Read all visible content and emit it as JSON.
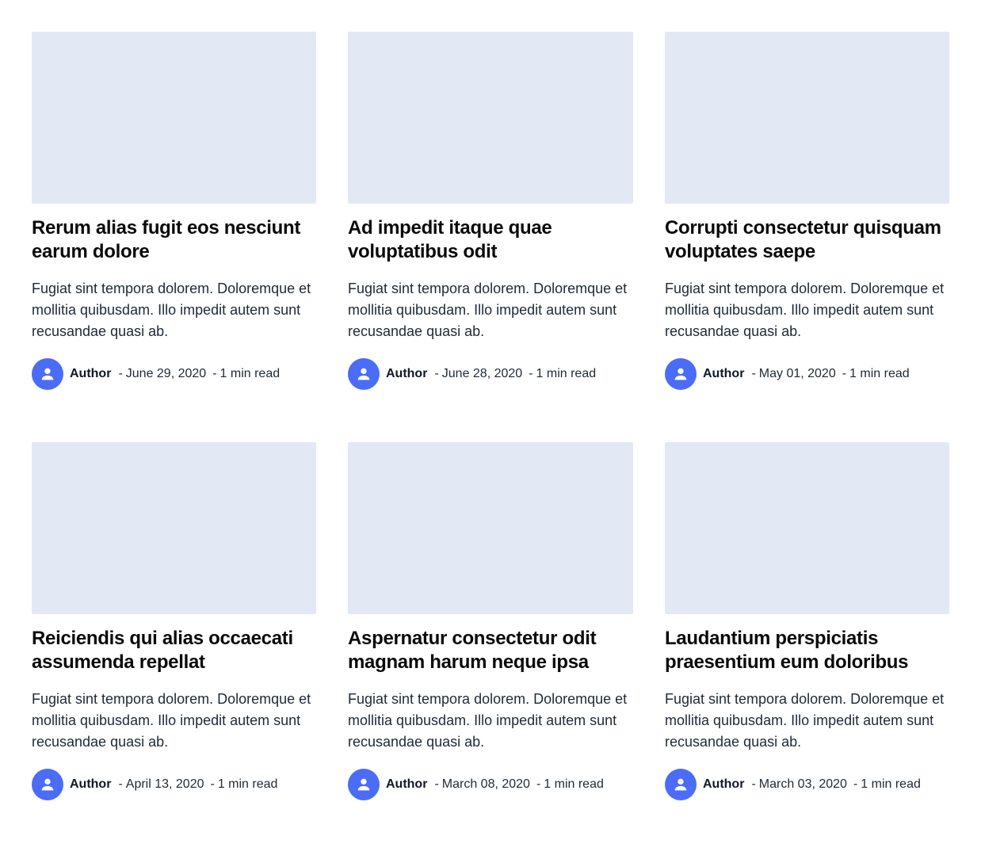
{
  "posts": [
    {
      "title": "Rerum alias fugit eos nesciunt earum dolore",
      "excerpt": "Fugiat sint tempora dolorem. Doloremque et mollitia quibusdam. Illo impedit autem sunt recusandae quasi ab.",
      "author": "Author",
      "date": "June 29, 2020",
      "read_time": "1 min read"
    },
    {
      "title": "Ad impedit itaque quae voluptatibus odit",
      "excerpt": "Fugiat sint tempora dolorem. Doloremque et mollitia quibusdam. Illo impedit autem sunt recusandae quasi ab.",
      "author": "Author",
      "date": "June 28, 2020",
      "read_time": "1 min read"
    },
    {
      "title": "Corrupti consectetur quisquam voluptates saepe",
      "excerpt": "Fugiat sint tempora dolorem. Doloremque et mollitia quibusdam. Illo impedit autem sunt recusandae quasi ab.",
      "author": "Author",
      "date": "May 01, 2020",
      "read_time": "1 min read"
    },
    {
      "title": "Reiciendis qui alias occaecati assumenda repellat",
      "excerpt": "Fugiat sint tempora dolorem. Doloremque et mollitia quibusdam. Illo impedit autem sunt recusandae quasi ab.",
      "author": "Author",
      "date": "April 13, 2020",
      "read_time": "1 min read"
    },
    {
      "title": "Aspernatur consectetur odit magnam harum neque ipsa",
      "excerpt": "Fugiat sint tempora dolorem. Doloremque et mollitia quibusdam. Illo impedit autem sunt recusandae quasi ab.",
      "author": "Author",
      "date": "March 08, 2020",
      "read_time": "1 min read"
    },
    {
      "title": "Laudantium perspiciatis praesentium eum doloribus",
      "excerpt": "Fugiat sint tempora dolorem. Doloremque et mollitia quibusdam. Illo impedit autem sunt recusandae quasi ab.",
      "author": "Author",
      "date": "March 03, 2020",
      "read_time": "1 min read"
    }
  ],
  "meta": {
    "separator": "-"
  },
  "colors": {
    "thumbnail_placeholder": "#e2e8f4",
    "avatar_bg": "#4a6cf7",
    "title_text": "#0a0a0a",
    "body_text": "#1f2937"
  },
  "icons": {
    "avatar": "user-icon"
  }
}
